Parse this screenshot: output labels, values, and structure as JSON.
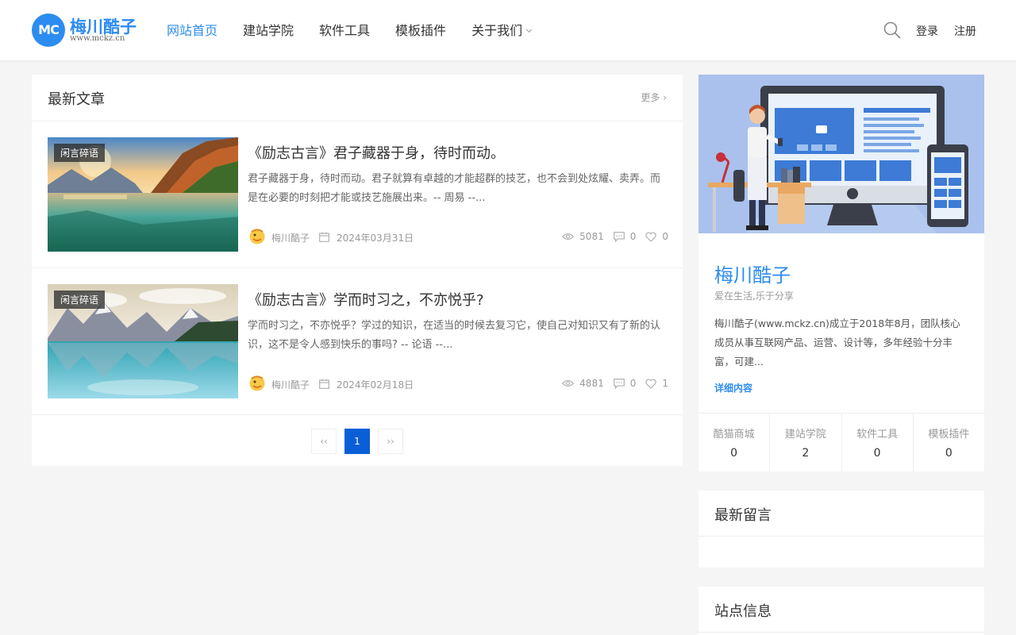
{
  "brand": {
    "mark": "MC",
    "name": "梅川酷子",
    "url": "www.mckz.cn",
    "color": "#2d8cf0"
  },
  "nav": {
    "items": [
      {
        "label": "网站首页",
        "active": true
      },
      {
        "label": "建站学院"
      },
      {
        "label": "软件工具"
      },
      {
        "label": "模板插件"
      },
      {
        "label": "关于我们",
        "has_dropdown": true
      }
    ],
    "search_icon": "search-icon",
    "login": "登录",
    "register": "注册"
  },
  "latest": {
    "title": "最新文章",
    "more": "更多",
    "posts": [
      {
        "category": "闲言碎语",
        "title": "《励志古言》君子藏器于身，待时而动。",
        "excerpt": "君子藏器于身，待时而动。君子就算有卓越的才能超群的技艺，也不会到处炫耀、卖弄。而是在必要的时刻把才能或技艺施展出来。-- 周易 --...",
        "author": "梅川酷子",
        "date": "2024年03月31日",
        "views": "5081",
        "comments": "0",
        "likes": "0"
      },
      {
        "category": "闲言碎语",
        "title": "《励志古言》学而时习之，不亦悦乎?",
        "excerpt": "学而时习之，不亦悦乎？学过的知识，在适当的时候去复习它，使自己对知识又有了新的认识，这不是令人感到快乐的事吗? -- 论语 --...",
        "author": "梅川酷子",
        "date": "2024年02月18日",
        "views": "4881",
        "comments": "0",
        "likes": "1"
      }
    ],
    "pagination": {
      "prev": "‹‹",
      "current": "1",
      "next": "››"
    }
  },
  "profile": {
    "name": "梅川酷子",
    "slogan": "爱在生活,乐于分享",
    "description": "梅川酷子(www.mckz.cn)成立于2018年8月，团队核心成员从事互联网产品、运营、设计等，多年经验十分丰富，可建...",
    "detail_link": "详细内容",
    "counts": [
      {
        "label": "酷猫商城",
        "value": "0"
      },
      {
        "label": "建站学院",
        "value": "2"
      },
      {
        "label": "软件工具",
        "value": "0"
      },
      {
        "label": "模板插件",
        "value": "0"
      }
    ]
  },
  "sidebar": {
    "comments_title": "最新留言",
    "siteinfo_title": "站点信息"
  },
  "colors": {
    "accent": "#2d8cf0",
    "page_active": "#0b5fd6",
    "background": "#f5f5f5"
  }
}
